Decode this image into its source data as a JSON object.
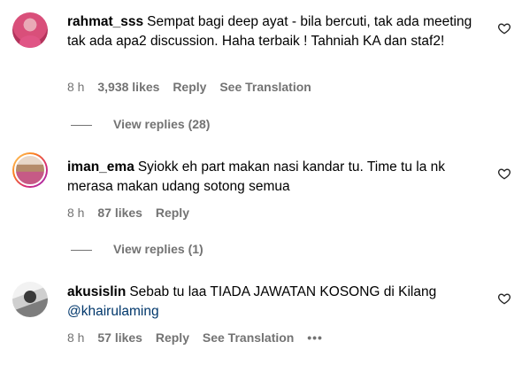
{
  "comments": [
    {
      "username": "rahmat_sss",
      "text": "Sempat bagi deep ayat - bila bercuti, tak ada meeting tak ada apa2 discussion. Haha terbaik ! Tahniah KA dan staf2!",
      "time": "8 h",
      "likes": "3,938 likes",
      "reply": "Reply",
      "see_translation": "See Translation",
      "view_replies": "View replies (28)"
    },
    {
      "username": "iman_ema",
      "text": "Syiokk eh part makan nasi kandar tu. Time tu la nk merasa makan udang sotong semua",
      "time": "8 h",
      "likes": "87 likes",
      "reply": "Reply",
      "view_replies": "View replies (1)"
    },
    {
      "username": "akusislin",
      "text": "Sebab tu laa TIADA JAWATAN KOSONG di Kilang",
      "mention": "@khairulaming",
      "time": "8 h",
      "likes": "57 likes",
      "reply": "Reply",
      "see_translation": "See Translation",
      "more": "•••"
    }
  ],
  "icons": {
    "like": "heart-outline-icon"
  }
}
